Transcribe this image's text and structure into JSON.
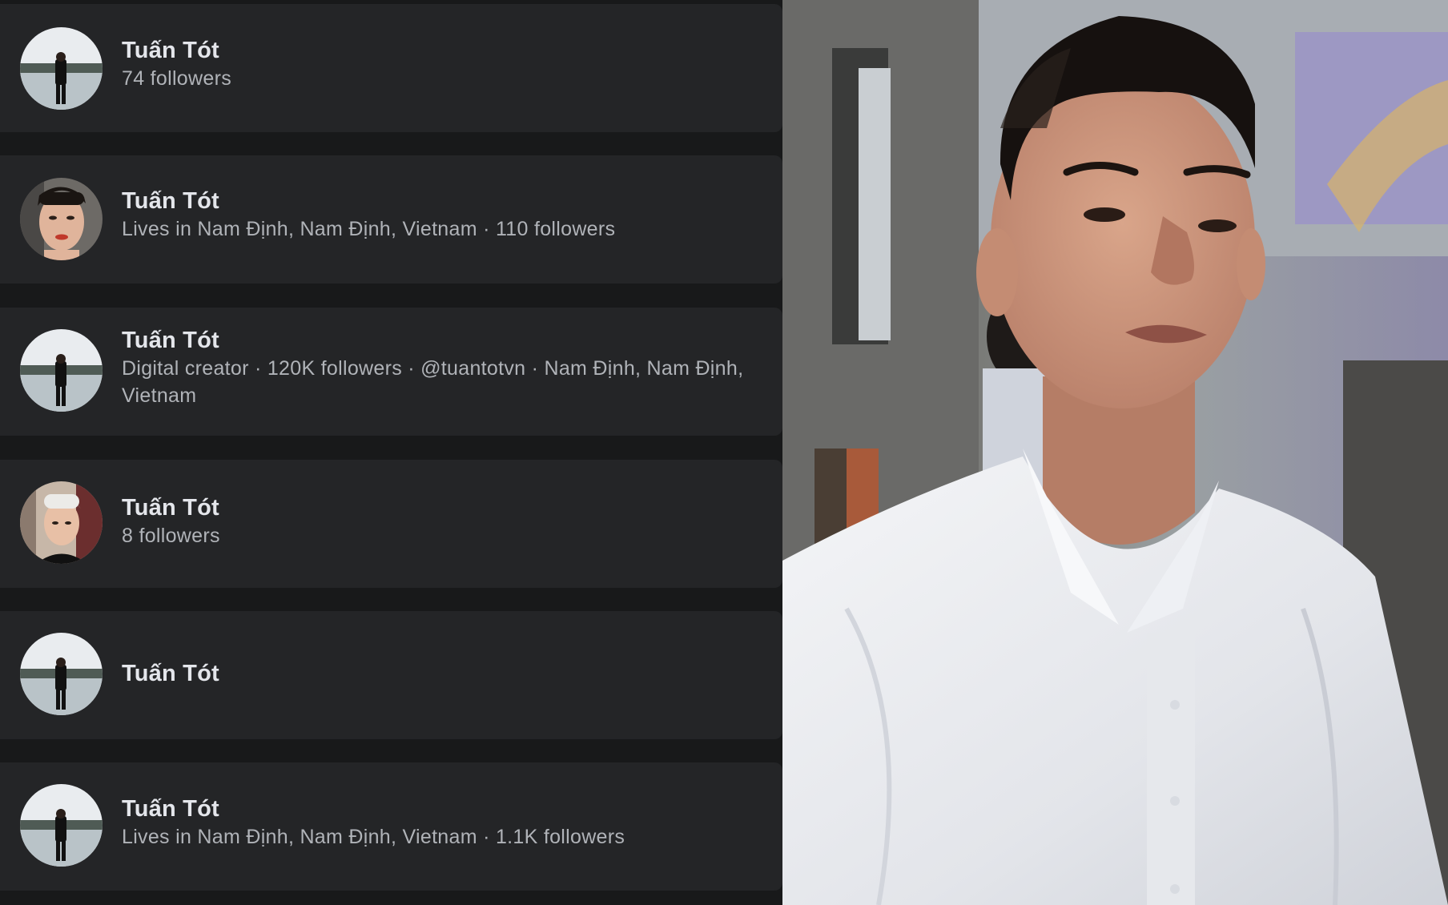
{
  "results": [
    {
      "name": "Tuấn Tót",
      "meta": "74 followers",
      "avatar": "lake-standing-avatar"
    },
    {
      "name": "Tuấn Tót",
      "meta": "Lives in Nam Định, Nam Định, Vietnam · 110 followers",
      "avatar": "selfie-avatar"
    },
    {
      "name": "Tuấn Tót",
      "meta": "Digital creator · 120K followers · @tuantotvn · Nam Định, Nam Định, Vietnam",
      "avatar": "lake-standing-avatar"
    },
    {
      "name": "Tuấn Tót",
      "meta": "8 followers",
      "avatar": "blond-selfie-avatar"
    },
    {
      "name": "Tuấn Tót",
      "meta": "",
      "avatar": "lake-standing-avatar"
    },
    {
      "name": "Tuấn Tót",
      "meta": "Lives in Nam Định, Nam Định, Vietnam · 1.1K followers",
      "avatar": "lake-standing-avatar"
    }
  ],
  "colors": {
    "background": "#18191a",
    "card": "#242527",
    "name_text": "#e4e6eb",
    "meta_text": "#b0b3b8"
  },
  "photo": {
    "subject": "young man in white shirt portrait"
  }
}
